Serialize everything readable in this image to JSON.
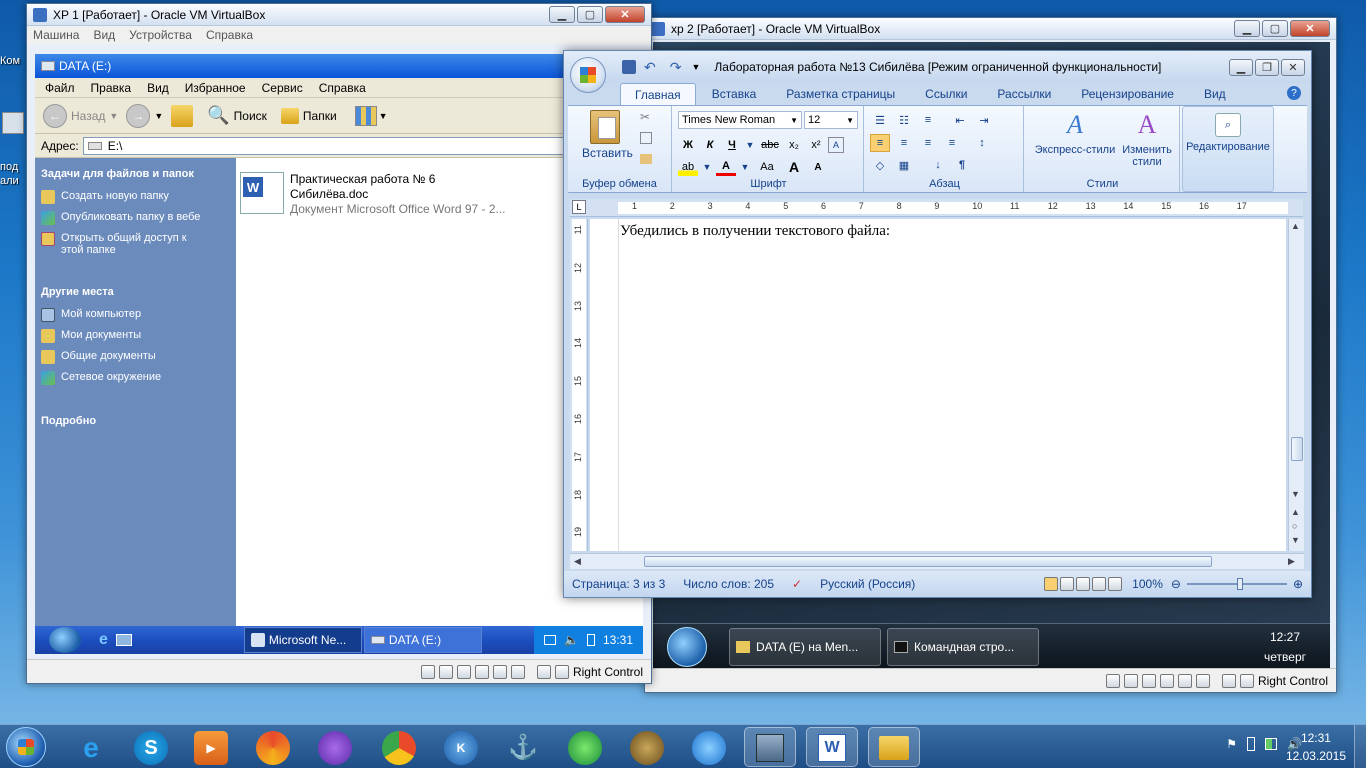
{
  "desktop": {
    "label_1": "Ком",
    "label_2": "под",
    "label_3": "али"
  },
  "vbox1": {
    "title": "XP 1 [Работает] - Oracle VM VirtualBox",
    "menu": [
      "Машина",
      "Вид",
      "Устройства",
      "Справка"
    ],
    "status_host_key": "Right Control"
  },
  "explorer": {
    "title": "DATA (E:)",
    "menu": [
      "Файл",
      "Правка",
      "Вид",
      "Избранное",
      "Сервис",
      "Справка"
    ],
    "toolbar": {
      "back": "Назад",
      "search": "Поиск",
      "folders": "Папки"
    },
    "address_label": "Адрес:",
    "address_value": "E:\\",
    "tasks": {
      "heading": "Задачи для файлов и папок",
      "items": [
        "Создать новую папку",
        "Опубликовать папку в вебе",
        "Открыть общий доступ к этой папке"
      ]
    },
    "places": {
      "heading": "Другие места",
      "items": [
        "Мой компьютер",
        "Мои документы",
        "Общие документы",
        "Сетевое окружение"
      ]
    },
    "details_heading": "Подробно",
    "file": {
      "name_line1": "Практическая работа № 6",
      "name_line2": "Сибилёва.doc",
      "type": "Документ Microsoft Office Word 97 - 2..."
    }
  },
  "xp_taskbar": {
    "btn1": "Microsoft Ne...",
    "btn2": "DATA (E:)",
    "clock": "13:31"
  },
  "vbox2": {
    "title": "xp 2 [Работает] - Oracle VM VirtualBox",
    "status_host_key": "Right Control"
  },
  "xp2_taskbar": {
    "btn1": "DATA (E) на Men...",
    "btn2": "Командная стро...",
    "clock_time": "12:27",
    "clock_day": "четверг"
  },
  "word": {
    "title": "Лабораторная работа №13 Сибилёва [Режим ограниченной функциональности]",
    "tabs": [
      "Главная",
      "Вставка",
      "Разметка страницы",
      "Ссылки",
      "Рассылки",
      "Рецензирование",
      "Вид"
    ],
    "clipboard": {
      "paste": "Вставить",
      "label": "Буфер обмена"
    },
    "font": {
      "name": "Times New Roman",
      "size": "12",
      "label": "Шрифт",
      "bold": "Ж",
      "italic": "К",
      "underline": "Ч",
      "strike": "abc",
      "sub": "x₂",
      "sup": "x²",
      "case": "Aa",
      "grow": "A",
      "shrink": "A"
    },
    "paragraph_label": "Абзац",
    "styles": {
      "quick": "Экспресс-стили",
      "change_1": "Изменить",
      "change_2": "стили",
      "label": "Стили"
    },
    "editing": "Редактирование",
    "ruler_h": [
      "1",
      "2",
      "3",
      "4",
      "5",
      "6",
      "7",
      "8",
      "9",
      "10",
      "11",
      "12",
      "13",
      "14",
      "15",
      "16",
      "17"
    ],
    "ruler_v": [
      "11",
      "12",
      "13",
      "14",
      "15",
      "16",
      "17",
      "18",
      "19"
    ],
    "doc_text": "Убедились в получении текстового файла:",
    "status": {
      "page": "Страница: 3 из 3",
      "words": "Число слов: 205",
      "lang": "Русский (Россия)",
      "zoom": "100%"
    }
  },
  "win7_tray": {
    "time": "12:31",
    "date": "12.03.2015"
  }
}
